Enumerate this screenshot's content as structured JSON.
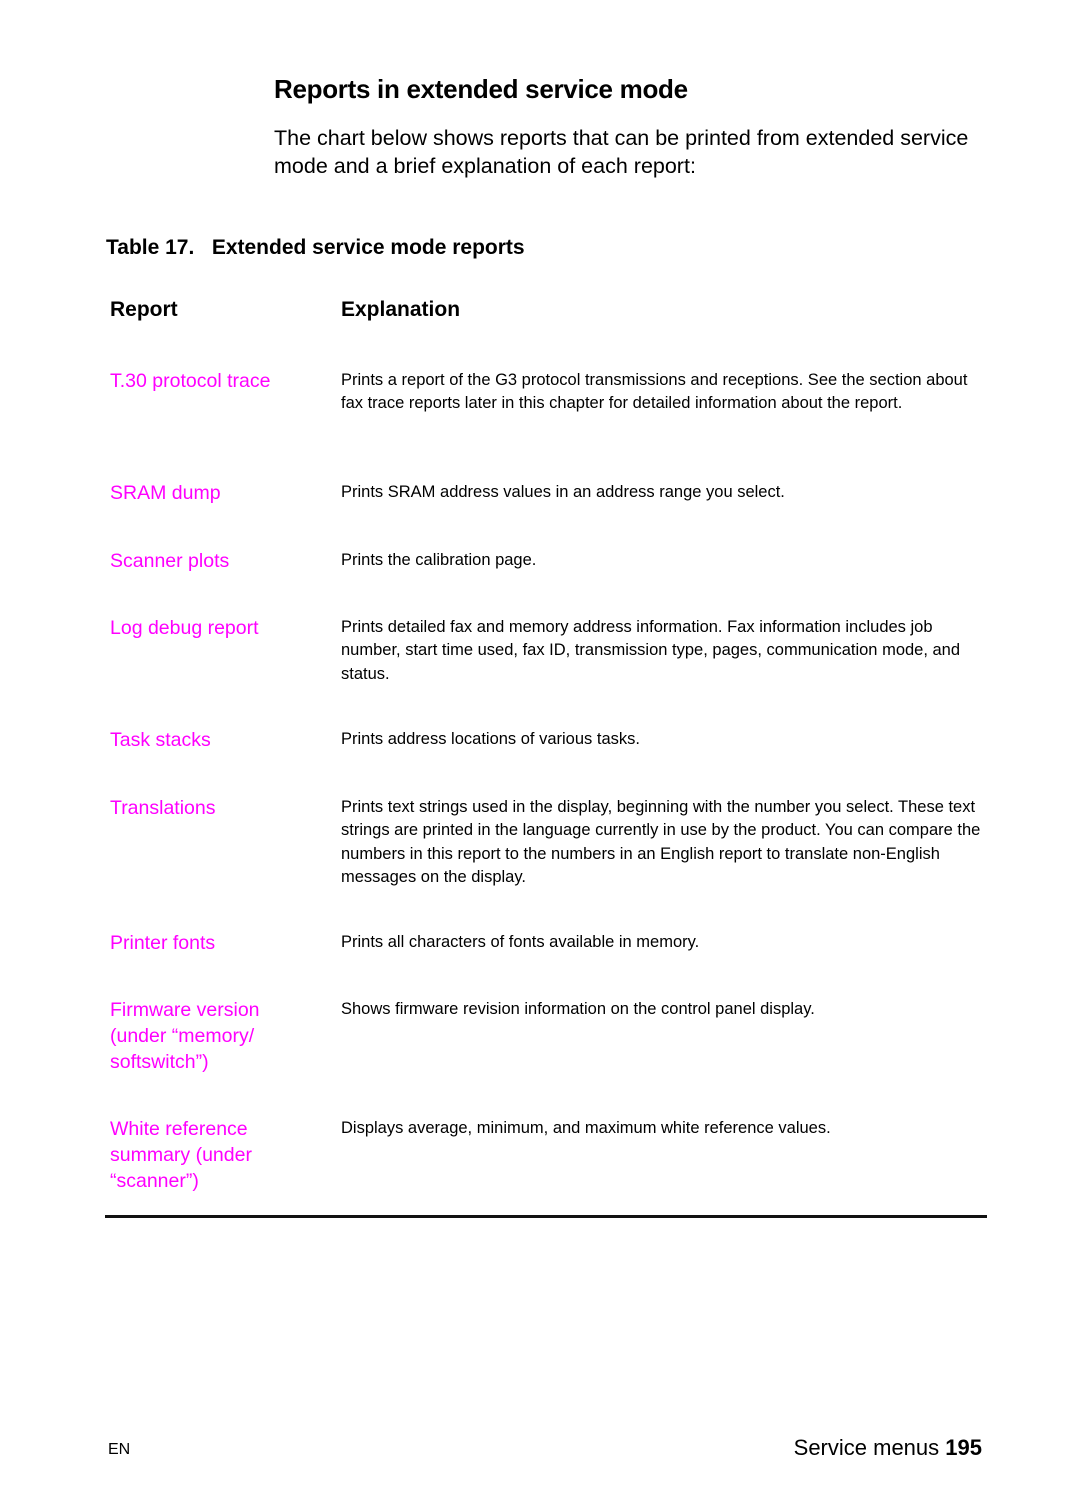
{
  "section": {
    "title": "Reports in extended service mode",
    "intro": "The chart below shows reports that can be printed from extended service mode and a brief explanation of each report:"
  },
  "table": {
    "caption": "Table 17.   Extended service mode reports",
    "headers": {
      "report": "Report",
      "explanation": "Explanation"
    },
    "link_color": "#ff00ff",
    "rows": [
      {
        "report": "T.30 protocol trace",
        "explanation": "Prints a report of the G3 protocol transmissions and receptions. See the section about fax trace reports later in this chapter for detailed information about the report."
      },
      {
        "report": "SRAM dump",
        "explanation": "Prints SRAM address values in an address range you select."
      },
      {
        "report": "Scanner plots",
        "explanation": "Prints the calibration page."
      },
      {
        "report": "Log debug report",
        "explanation": "Prints detailed fax and memory address information. Fax information includes job number, start time used, fax ID, transmission type, pages, communication mode, and status."
      },
      {
        "report": "Task stacks",
        "explanation": "Prints address locations of various tasks."
      },
      {
        "report": "Translations",
        "explanation": "Prints text strings used in the display, beginning with the number you select. These text strings are printed in the language currently in use by the product. You can compare the numbers in this report to the numbers in an English report to translate non-English messages on the display."
      },
      {
        "report": "Printer fonts",
        "explanation": "Prints all characters of fonts available in memory."
      },
      {
        "report": "Firmware version (under “memory/ softswitch”)",
        "explanation": "Shows firmware revision information on the control panel display."
      },
      {
        "report": "White reference summary (under “scanner”)",
        "explanation": "Displays average, minimum, and maximum white reference values."
      }
    ]
  },
  "footer": {
    "language": "EN",
    "section_name": "Service menus",
    "page_number": "195"
  }
}
